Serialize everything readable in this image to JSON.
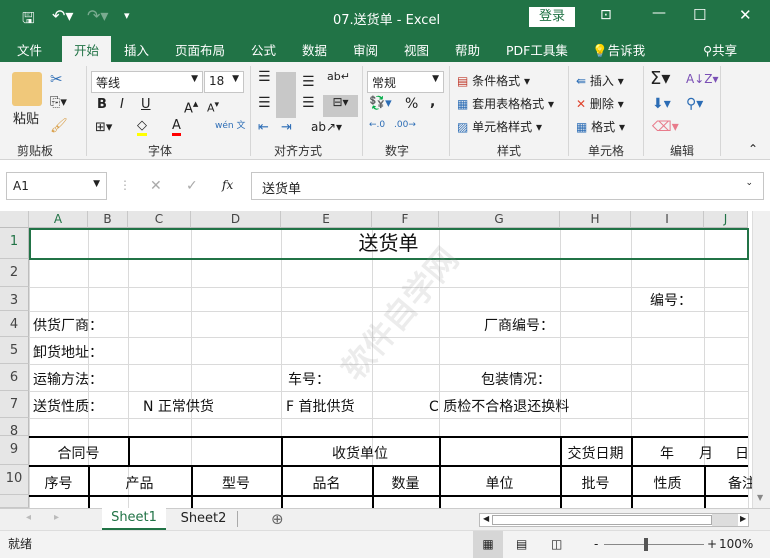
{
  "titlebar": {
    "title": "07.送货单  -  Excel",
    "login": "登录",
    "qat": [
      "save-icon",
      "undo-icon",
      "redo-icon",
      "customize-icon"
    ]
  },
  "ribbon_tabs": [
    "文件",
    "开始",
    "插入",
    "页面布局",
    "公式",
    "数据",
    "审阅",
    "视图",
    "帮助",
    "PDF工具集",
    "告诉我",
    "共享"
  ],
  "ribbon": {
    "clipboard": {
      "paste": "粘贴",
      "label": "剪贴板"
    },
    "font": {
      "name": "等线",
      "size": "18",
      "label": "字体",
      "bold": "B",
      "italic": "I",
      "underline": "U",
      "phonetic": "wén 文"
    },
    "alignment": {
      "label": "对齐方式"
    },
    "number": {
      "format": "常规",
      "label": "数字",
      "percent": "%",
      "comma": ","
    },
    "styles": {
      "conditional": "条件格式",
      "table": "套用表格格式",
      "cell": "单元格样式",
      "label": "样式"
    },
    "cells": {
      "insert": "插入",
      "delete": "删除",
      "format": "格式",
      "label": "单元格"
    },
    "editing": {
      "label": "编辑"
    }
  },
  "formula_bar": {
    "name_box": "A1",
    "value": "送货单",
    "fx": "fx"
  },
  "columns": [
    "A",
    "B",
    "C",
    "D",
    "E",
    "F",
    "G",
    "H",
    "I",
    "J"
  ],
  "rows": [
    "1",
    "2",
    "3",
    "4",
    "5",
    "6",
    "7",
    "8",
    "9",
    "10"
  ],
  "cells": {
    "title": "送货单",
    "number": "编号：",
    "supplier": "供货厂商：",
    "supplier_no": "厂商编号：",
    "address": "卸货地址：",
    "transport": "运输方法：",
    "car_no": "车号：",
    "packing": "包装情况：",
    "nature": "送货性质：",
    "n": "N 正常供货",
    "f": "F  首批供货",
    "c": "C  质检不合格退还换料",
    "contract": "合同号",
    "receiver": "收货单位",
    "delivery_date": "交货日期",
    "year": "年",
    "month": "月",
    "day": "日",
    "headers": [
      "序号",
      "产品",
      "型号",
      "品名",
      "数量",
      "单位",
      "批号",
      "性质",
      "备注"
    ]
  },
  "watermark": "软件自学网 RJZXW.COM",
  "sheets": [
    "Sheet1",
    "Sheet2"
  ],
  "status": {
    "ready": "就绪",
    "zoom": "100%"
  }
}
